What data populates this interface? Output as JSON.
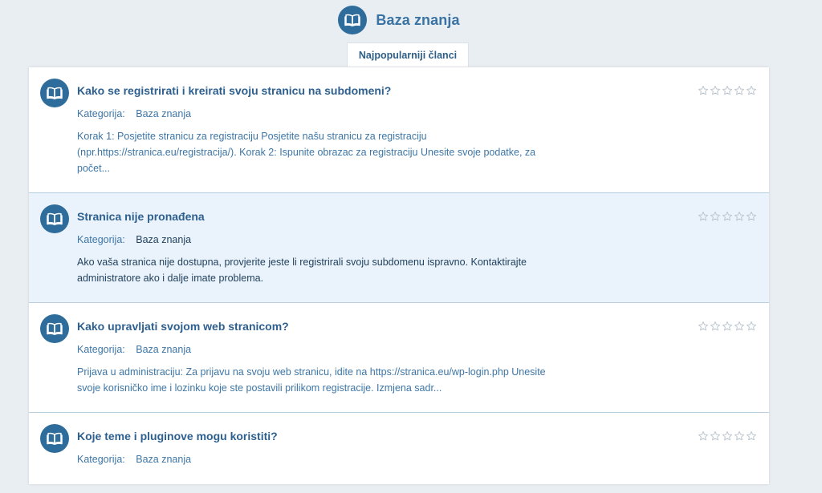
{
  "header": {
    "title": "Baza znanja",
    "icon": "book-open-icon"
  },
  "tab": {
    "label": "Najpopularniji članci"
  },
  "articles": [
    {
      "title": "Kako se registrirati i kreirati svoju stranicu na subdomeni?",
      "category_label": "Kategorija:",
      "category_value": "Baza znanja",
      "excerpt": "Korak 1: Posjetite stranicu za registraciju Posjetite našu stranicu za registraciju (npr.https://stranica.eu/registracija/).   Korak 2: Ispunite obrazac za registraciju Unesite svoje podatke, za počet...",
      "rating": 0,
      "highlighted": false
    },
    {
      "title": "Stranica nije pronađena",
      "category_label": "Kategorija:",
      "category_value": "Baza znanja",
      "excerpt": "Ako vaša stranica nije dostupna, provjerite jeste li registrirali svoju subdomenu ispravno. Kontaktirajte administratore ako i dalje imate problema.",
      "rating": 0,
      "highlighted": true
    },
    {
      "title": "Kako upravljati svojom web stranicom?",
      "category_label": "Kategorija:",
      "category_value": "Baza znanja",
      "excerpt": "Prijava u administraciju:   Za prijavu na svoju web stranicu, idite na https://stranica.eu/wp-login.php  Unesite svoje korisničko ime i lozinku koje ste postavili prilikom registracije.   Izmjena sadr...",
      "rating": 0,
      "highlighted": false
    },
    {
      "title": "Koje teme i pluginove mogu koristiti?",
      "category_label": "Kategorija:",
      "category_value": "Baza znanja",
      "excerpt": "",
      "rating": 0,
      "highlighted": false
    }
  ],
  "colors": {
    "accent": "#2e6c9c",
    "title": "#2d5f8f",
    "link": "#3d76a6",
    "highlight_bg": "#eaf3fb",
    "page_bg": "#e9eef2"
  }
}
